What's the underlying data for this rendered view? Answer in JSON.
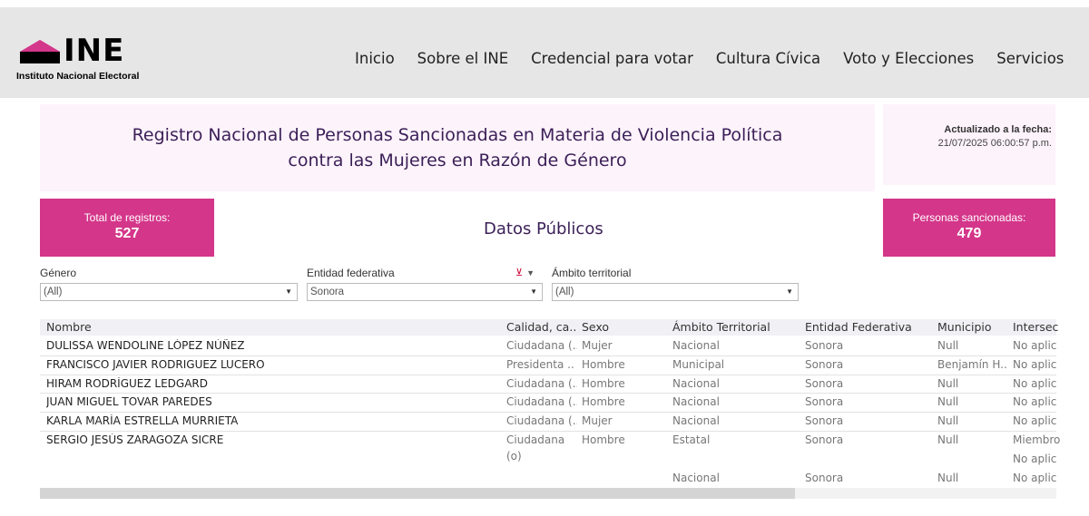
{
  "header": {
    "logo_text": "INE",
    "logo_subtitle": "Instituto Nacional Electoral",
    "nav": [
      "Inicio",
      "Sobre el INE",
      "Credencial para votar",
      "Cultura Cívica",
      "Voto y Elecciones",
      "Servicios"
    ]
  },
  "title": {
    "line1": "Registro Nacional de Personas Sancionadas en Materia de Violencia Política",
    "line2": "contra las Mujeres en Razón de Género"
  },
  "updated": {
    "label": "Actualizado a la fecha:",
    "value": "21/07/2025 06:00:57 p.m."
  },
  "stats": {
    "total": {
      "label": "Total de registros:",
      "value": "527"
    },
    "sanctioned": {
      "label": "Personas sancionadas:",
      "value": "479"
    }
  },
  "section_title": "Datos Públicos",
  "filters": {
    "genero": {
      "label": "Género",
      "value": "(All)"
    },
    "entidad": {
      "label": "Entidad federativa",
      "value": "Sonora"
    },
    "ambito": {
      "label": "Ámbito territorial",
      "value": "(All)"
    }
  },
  "table": {
    "headers": [
      "Nombre",
      "Calidad, ca..",
      "Sexo",
      "Ámbito Territorial",
      "Entidad Federativa",
      "Municipio",
      "Intersec"
    ],
    "rows": [
      [
        "DULISSA WENDOLINE LÓPEZ NÚÑEZ",
        "Ciudadana (..",
        "Mujer",
        "Nacional",
        "Sonora",
        "Null",
        "No aplic"
      ],
      [
        "FRANCISCO JAVIER RODRIGUEZ LUCERO",
        "Presidenta ..",
        "Hombre",
        "Municipal",
        "Sonora",
        "Benjamín H..",
        "No aplic"
      ],
      [
        "HIRAM RODRÍGUEZ LEDGARD",
        "Ciudadana (..",
        "Hombre",
        "Nacional",
        "Sonora",
        "Null",
        "No aplic"
      ],
      [
        "JUAN MIGUEL TOVAR PAREDES",
        "Ciudadana (..",
        "Hombre",
        "Nacional",
        "Sonora",
        "Null",
        "No aplic"
      ],
      [
        "KARLA MARÍA ESTRELLA MURRIETA",
        "Ciudadana (..",
        "Mujer",
        "Nacional",
        "Sonora",
        "Null",
        "No aplic"
      ]
    ],
    "last_row": {
      "name": "SERGIO JESÚS ZARAGOZA SICRE",
      "calidad_line1": "Ciudadana",
      "calidad_line2": "(o)",
      "sexo": "Hombre",
      "sub": [
        {
          "ambito": "Estatal",
          "entidad": "Sonora",
          "municipio": "Null",
          "intersec": [
            "Miembro",
            "No aplic"
          ]
        },
        {
          "ambito": "Nacional",
          "entidad": "Sonora",
          "municipio": "Null",
          "intersec": [
            "No aplic"
          ]
        }
      ]
    }
  },
  "colors": {
    "accent": "#d4368a",
    "title": "#3b1f57",
    "panel": "#fdf3fb"
  }
}
